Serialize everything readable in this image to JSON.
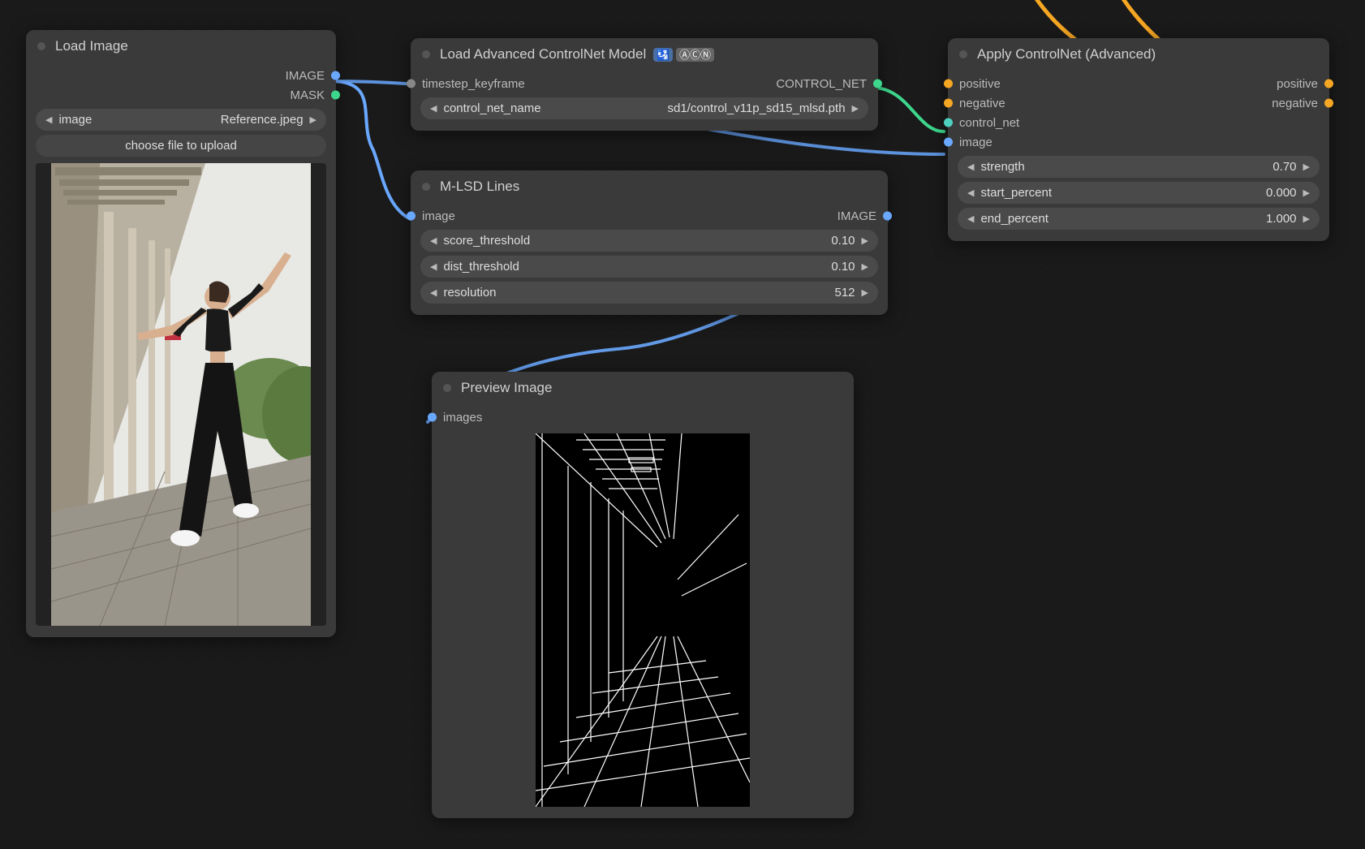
{
  "nodes": {
    "load_image": {
      "title": "Load Image",
      "outputs": {
        "image": "IMAGE",
        "mask": "MASK"
      },
      "widgets": {
        "image_label": "image",
        "image_value": "Reference.jpeg",
        "upload_button": "choose file to upload"
      }
    },
    "load_controlnet": {
      "title": "Load Advanced ControlNet Model",
      "badges": {
        "b1": "🛂",
        "b2": "ⒶⒸⓃ"
      },
      "inputs": {
        "timestep_keyframe": "timestep_keyframe"
      },
      "outputs": {
        "control_net": "CONTROL_NET"
      },
      "widgets": {
        "control_net_name_label": "control_net_name",
        "control_net_name_value": "sd1/control_v11p_sd15_mlsd.pth"
      }
    },
    "mlsd": {
      "title": "M-LSD Lines",
      "inputs": {
        "image": "image"
      },
      "outputs": {
        "image": "IMAGE"
      },
      "widgets": {
        "score_threshold_label": "score_threshold",
        "score_threshold_value": "0.10",
        "dist_threshold_label": "dist_threshold",
        "dist_threshold_value": "0.10",
        "resolution_label": "resolution",
        "resolution_value": "512"
      }
    },
    "preview": {
      "title": "Preview Image",
      "inputs": {
        "images": "images"
      }
    },
    "apply_controlnet": {
      "title": "Apply ControlNet (Advanced)",
      "inputs": {
        "positive": "positive",
        "negative": "negative",
        "control_net": "control_net",
        "image": "image"
      },
      "outputs": {
        "positive": "positive",
        "negative": "negative"
      },
      "widgets": {
        "strength_label": "strength",
        "strength_value": "0.70",
        "start_percent_label": "start_percent",
        "start_percent_value": "0.000",
        "end_percent_label": "end_percent",
        "end_percent_value": "1.000"
      }
    }
  }
}
